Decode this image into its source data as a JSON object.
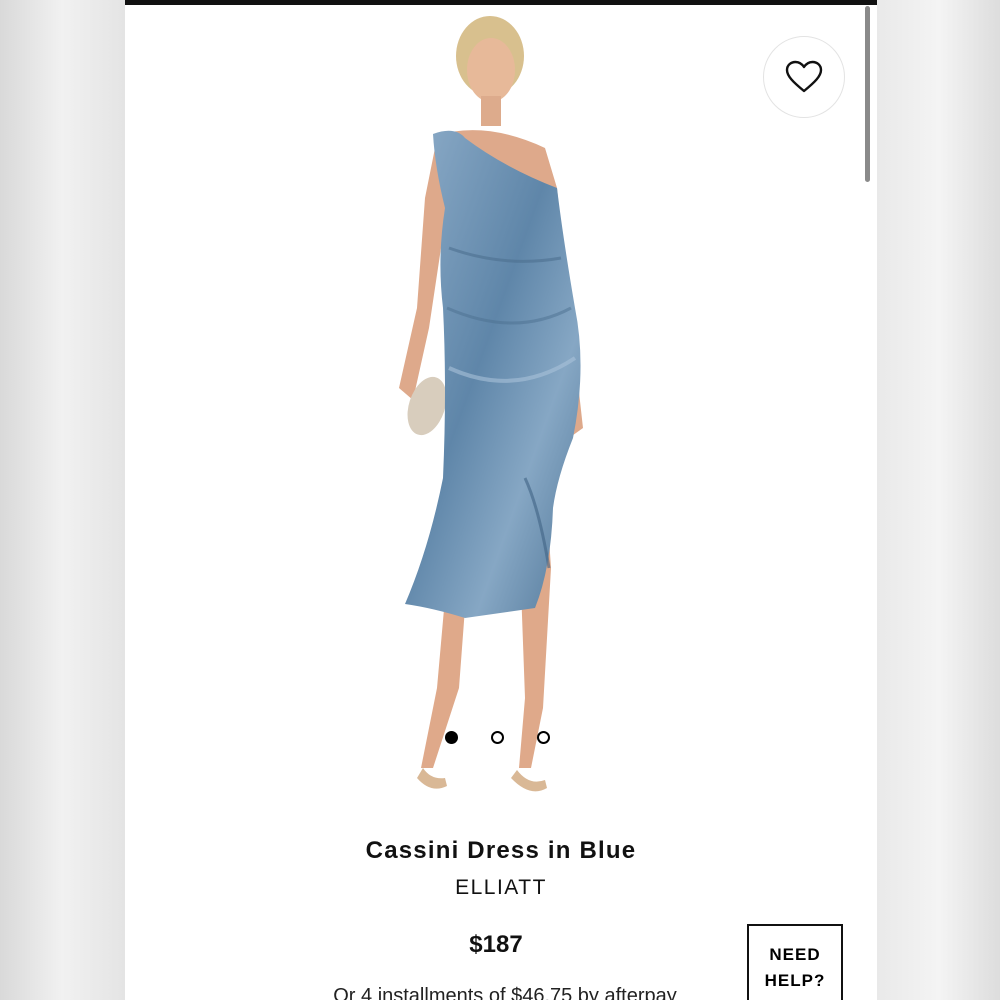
{
  "product": {
    "title": "Cassini Dress in Blue",
    "brand": "ELLIATT",
    "price": "$187",
    "installments_text": "Or 4 installments of $46.75 by afterpay"
  },
  "gallery": {
    "dot_count": 3,
    "active_index": 0
  },
  "actions": {
    "wishlist_icon": "heart-icon",
    "help_label": "NEED HELP?"
  },
  "colors": {
    "dress": "#6f93b3",
    "accent_dark": "#111111"
  }
}
